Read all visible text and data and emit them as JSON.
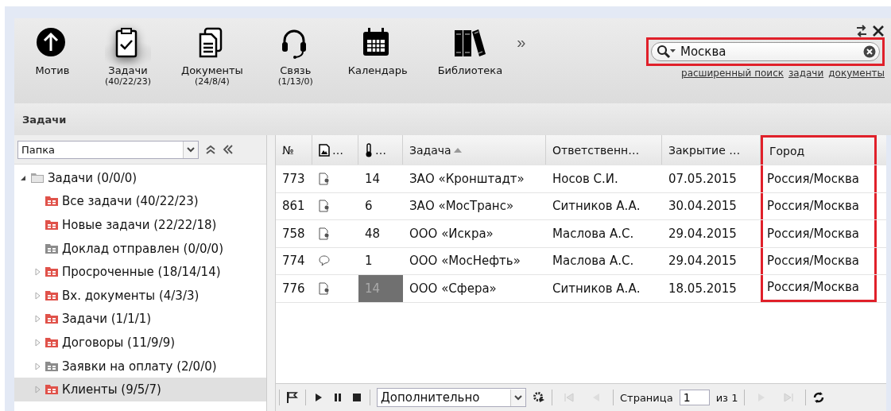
{
  "toolbar": {
    "items": [
      {
        "kind": "arrow",
        "label": "Мотив",
        "selected": false
      },
      {
        "kind": "clipboard",
        "label": "Задачи",
        "count": "(40/22/23)",
        "selected": true
      },
      {
        "kind": "docs",
        "label": "Документы",
        "count": "(24/8/4)",
        "selected": false
      },
      {
        "kind": "headset",
        "label": "Связь",
        "count": "(1/13/0)",
        "selected": false
      },
      {
        "kind": "calendar",
        "label": "Календарь",
        "selected": false
      },
      {
        "kind": "books",
        "label": "Библиотека",
        "selected": false
      }
    ],
    "more": "»"
  },
  "search": {
    "value": "Москва",
    "highlighted": true,
    "links": [
      "расширенный поиск",
      "задачи",
      "документы"
    ]
  },
  "section_title": "Задачи",
  "folder_select": {
    "value": "Папка"
  },
  "tree": [
    {
      "label": "Задачи (0/0/0)",
      "color": "#a8a8a8",
      "expanded": true,
      "selected": false,
      "children": [
        {
          "label": "Все задачи (40/22/23)",
          "color": "#e0524a",
          "selected": false
        },
        {
          "label": "Новые задачи (22/22/18)",
          "color": "#e0524a",
          "selected": false
        },
        {
          "label": "Доклад отправлен (0/0/0)",
          "color": "#8c8c8c",
          "selected": false
        },
        {
          "label": "Просроченные (18/14/14)",
          "color": "#e0524a",
          "expanded": false,
          "selected": false
        },
        {
          "label": "Вх. документы (4/3/3)",
          "color": "#e0524a",
          "expanded": false,
          "selected": false
        },
        {
          "label": "Задачи (1/1/1)",
          "color": "#e0524a",
          "expanded": false,
          "selected": false
        },
        {
          "label": "Договоры (11/9/9)",
          "color": "#e0524a",
          "expanded": false,
          "selected": false
        },
        {
          "label": "Заявки на оплату (2/0/0)",
          "color": "#8c8c8c",
          "expanded": false,
          "selected": false
        },
        {
          "label": "Клиенты (9/5/7)",
          "color": "#e0524a",
          "expanded": false,
          "selected": true
        }
      ]
    }
  ],
  "table": {
    "columns": [
      {
        "kind": "text",
        "label": "№",
        "highlighted": false
      },
      {
        "kind": "icon",
        "label": "…",
        "highlighted": false
      },
      {
        "kind": "thermo",
        "label": "…",
        "highlighted": false
      },
      {
        "kind": "text",
        "label": "Задача",
        "sorted": true,
        "highlighted": false
      },
      {
        "kind": "text",
        "label": "Ответственн…",
        "highlighted": false
      },
      {
        "kind": "text",
        "label": "Закрытие …",
        "highlighted": false
      },
      {
        "kind": "text",
        "label": "Город",
        "highlighted": true
      }
    ],
    "rows": [
      {
        "number": "773",
        "kind": "document",
        "temp": "14",
        "temp_dimmed": false,
        "task": "ЗАО «Кронштадт»",
        "owner": "Носов С.И.",
        "closing": "07.05.2015",
        "city": "Россия/Москва"
      },
      {
        "number": "861",
        "kind": "document",
        "temp": "6",
        "temp_dimmed": false,
        "task": "ЗАО «МосТранс»",
        "owner": "Ситников А.А.",
        "closing": "30.04.2015",
        "city": "Россия/Москва"
      },
      {
        "number": "758",
        "kind": "document",
        "temp": "48",
        "temp_dimmed": false,
        "task": "ООО «Искра»",
        "owner": "Маслова А.С.",
        "closing": "29.04.2015",
        "city": "Россия/Москва"
      },
      {
        "number": "774",
        "kind": "comment",
        "temp": "1",
        "temp_dimmed": false,
        "task": "ООО «МосНефть»",
        "owner": "Маслова А.С.",
        "closing": "29.04.2015",
        "city": "Россия/Москва"
      },
      {
        "number": "776",
        "kind": "document",
        "temp": "14",
        "temp_dimmed": true,
        "task": "ООО «Сфера»",
        "owner": "Ситников А.А.",
        "closing": "18.05.2015",
        "city": "Россия/Москва"
      }
    ]
  },
  "pager": {
    "filter": "Дополнительно",
    "page_label": "Страница",
    "page": "1",
    "of": "из 1"
  }
}
